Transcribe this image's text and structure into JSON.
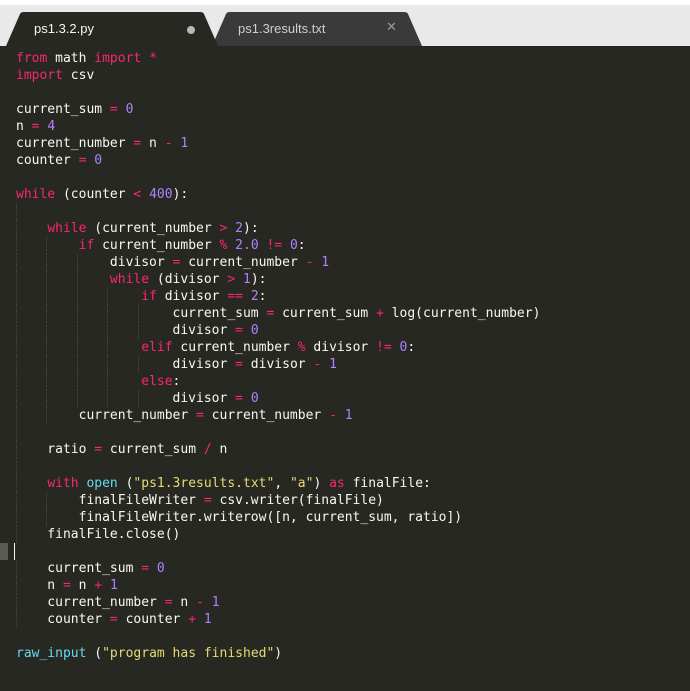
{
  "tabs": [
    {
      "label": "ps1.3.2.py",
      "active": true,
      "indicator": "modified-dot-icon"
    },
    {
      "label": "ps1.3results.txt",
      "active": false,
      "indicator": "close-icon"
    }
  ],
  "colors": {
    "background": "#272822",
    "keyword": "#f92672",
    "number": "#ae81ff",
    "string": "#e6db74",
    "function": "#66d9ef",
    "text": "#f8f8f2"
  },
  "code_lines": [
    {
      "line": 1,
      "text": "from math import *"
    },
    {
      "line": 2,
      "text": "import csv"
    },
    {
      "line": 3,
      "text": ""
    },
    {
      "line": 4,
      "text": "current_sum = 0"
    },
    {
      "line": 5,
      "text": "n = 4"
    },
    {
      "line": 6,
      "text": "current_number = n - 1"
    },
    {
      "line": 7,
      "text": "counter = 0"
    },
    {
      "line": 8,
      "text": ""
    },
    {
      "line": 9,
      "text": "while (counter < 400):"
    },
    {
      "line": 10,
      "text": ""
    },
    {
      "line": 11,
      "text": "    while (current_number > 2):"
    },
    {
      "line": 12,
      "text": "        if current_number % 2.0 != 0:"
    },
    {
      "line": 13,
      "text": "            divisor = current_number - 1"
    },
    {
      "line": 14,
      "text": "            while (divisor > 1):"
    },
    {
      "line": 15,
      "text": "                if divisor == 2:"
    },
    {
      "line": 16,
      "text": "                    current_sum = current_sum + log(current_number)"
    },
    {
      "line": 17,
      "text": "                    divisor = 0"
    },
    {
      "line": 18,
      "text": "                elif current_number % divisor != 0:"
    },
    {
      "line": 19,
      "text": "                    divisor = divisor - 1"
    },
    {
      "line": 20,
      "text": "                else:"
    },
    {
      "line": 21,
      "text": "                    divisor = 0"
    },
    {
      "line": 22,
      "text": "        current_number = current_number - 1"
    },
    {
      "line": 23,
      "text": ""
    },
    {
      "line": 24,
      "text": "    ratio = current_sum / n"
    },
    {
      "line": 25,
      "text": ""
    },
    {
      "line": 26,
      "text": "    with open (\"ps1.3results.txt\", \"a\") as finalFile:"
    },
    {
      "line": 27,
      "text": "        finalFileWriter = csv.writer(finalFile)"
    },
    {
      "line": 28,
      "text": "        finalFileWriter.writerow([n, current_sum, ratio])"
    },
    {
      "line": 29,
      "text": "    finalFile.close()"
    },
    {
      "line": 30,
      "text": ""
    },
    {
      "line": 31,
      "text": "    current_sum = 0"
    },
    {
      "line": 32,
      "text": "    n = n + 1"
    },
    {
      "line": 33,
      "text": "    current_number = n - 1"
    },
    {
      "line": 34,
      "text": "    counter = counter + 1"
    },
    {
      "line": 35,
      "text": ""
    },
    {
      "line": 36,
      "text": "raw_input (\"program has finished\")"
    }
  ],
  "cursor_line": 30
}
